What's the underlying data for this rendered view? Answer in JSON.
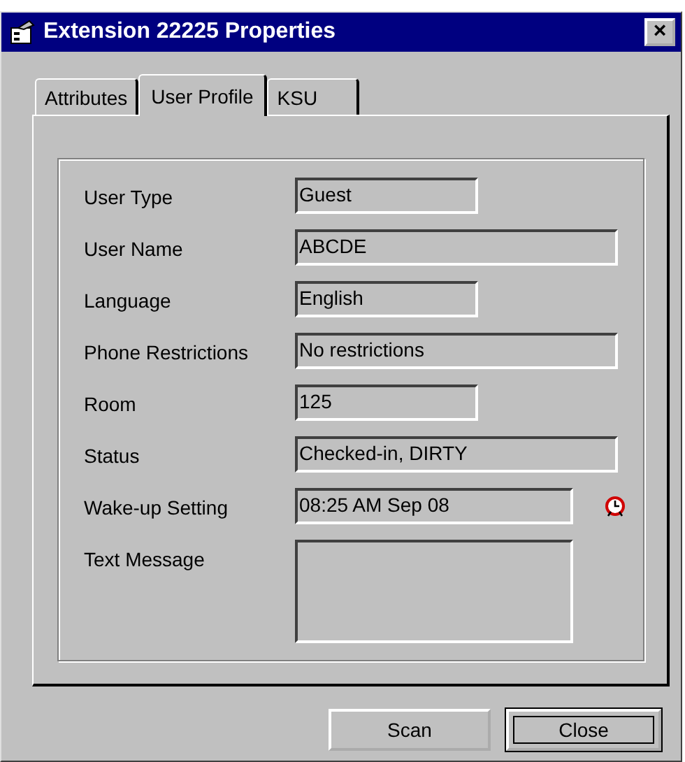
{
  "window": {
    "title": "Extension 22225 Properties",
    "close": "×"
  },
  "tabs": [
    {
      "label": "Attributes",
      "selected": false
    },
    {
      "label": "User Profile",
      "selected": true
    },
    {
      "label": "KSU",
      "selected": false
    }
  ],
  "fields": [
    {
      "label": "User Type",
      "value": "Guest",
      "kind": "short"
    },
    {
      "label": "User Name",
      "value": "ABCDE",
      "kind": "long"
    },
    {
      "label": "Language",
      "value": "English",
      "kind": "short"
    },
    {
      "label": "Phone Restrictions",
      "value": "No restrictions",
      "kind": "long"
    },
    {
      "label": "Room",
      "value": "125",
      "kind": "short"
    },
    {
      "label": "Status",
      "value": "Checked-in, DIRTY",
      "kind": "long"
    },
    {
      "label": "Wake-up Setting",
      "value": "08:25 AM Sep 08",
      "kind": "time"
    },
    {
      "label": "Text Message",
      "kind": "memo"
    }
  ],
  "buttons": [
    {
      "label": "Scan",
      "focused": false
    },
    {
      "label": "Close",
      "focused": true
    }
  ]
}
